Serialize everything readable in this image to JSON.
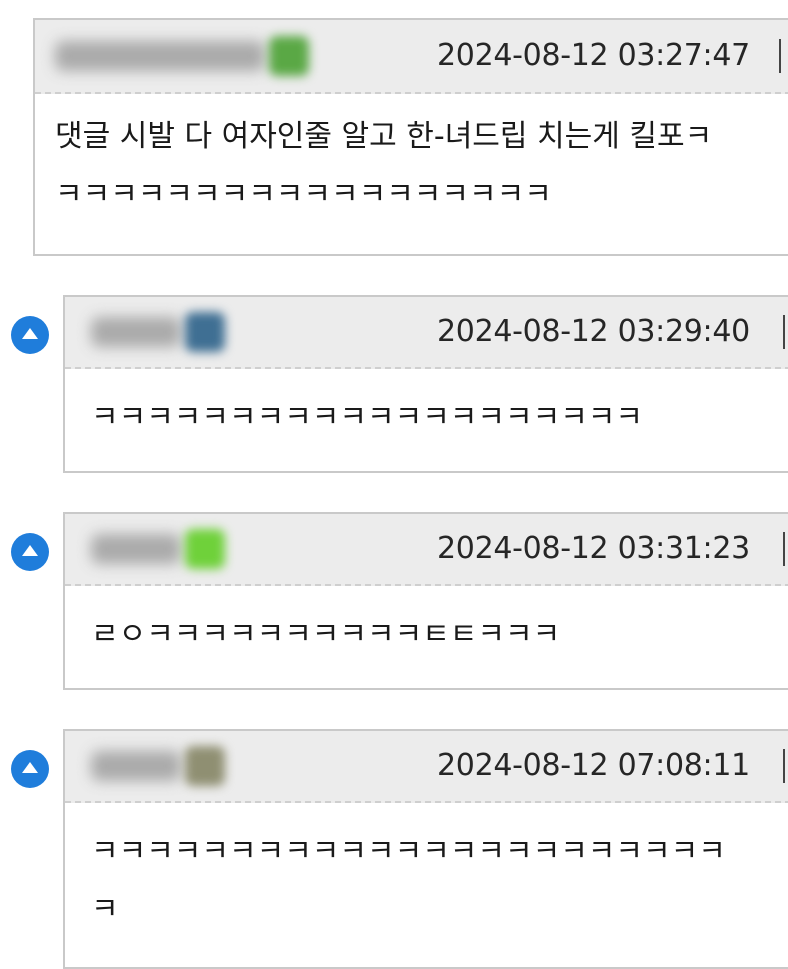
{
  "comments": [
    {
      "timestamp": "2024-08-12 03:27:47",
      "body_lines": [
        "댓글 시발 다 여자인줄 알고 한-녀드립 치는게 킬포ㅋ",
        "ㅋㅋㅋㅋㅋㅋㅋㅋㅋㅋㅋㅋㅋㅋㅋㅋㅋㅋ"
      ],
      "avatar_color": "#5aa845"
    },
    {
      "timestamp": "2024-08-12 03:29:40",
      "body_lines": [
        "ㅋㅋㅋㅋㅋㅋㅋㅋㅋㅋㅋㅋㅋㅋㅋㅋㅋㅋㅋㅋ"
      ],
      "avatar_color": "#3f6f93"
    },
    {
      "timestamp": "2024-08-12 03:31:23",
      "body_lines": [
        "ㄹㅇㅋㅋㅋㅋㅋㅋㅋㅋㅋㅋㅌㅌㅋㅋㅋ"
      ],
      "avatar_color": "#6fd13a"
    },
    {
      "timestamp": "2024-08-12 07:08:11",
      "body_lines": [
        "ㅋㅋㅋㅋㅋㅋㅋㅋㅋㅋㅋㅋㅋㅋㅋㅋㅋㅋㅋㅋㅋㅋㅋ",
        "ㅋ"
      ],
      "avatar_color": "#8f8f72"
    }
  ],
  "colors": {
    "reply_icon": "#1f7ddb",
    "header_bg": "#ececec",
    "border": "#c9c9c9"
  },
  "icons": {
    "reply": "reply-up-arrow-icon"
  }
}
